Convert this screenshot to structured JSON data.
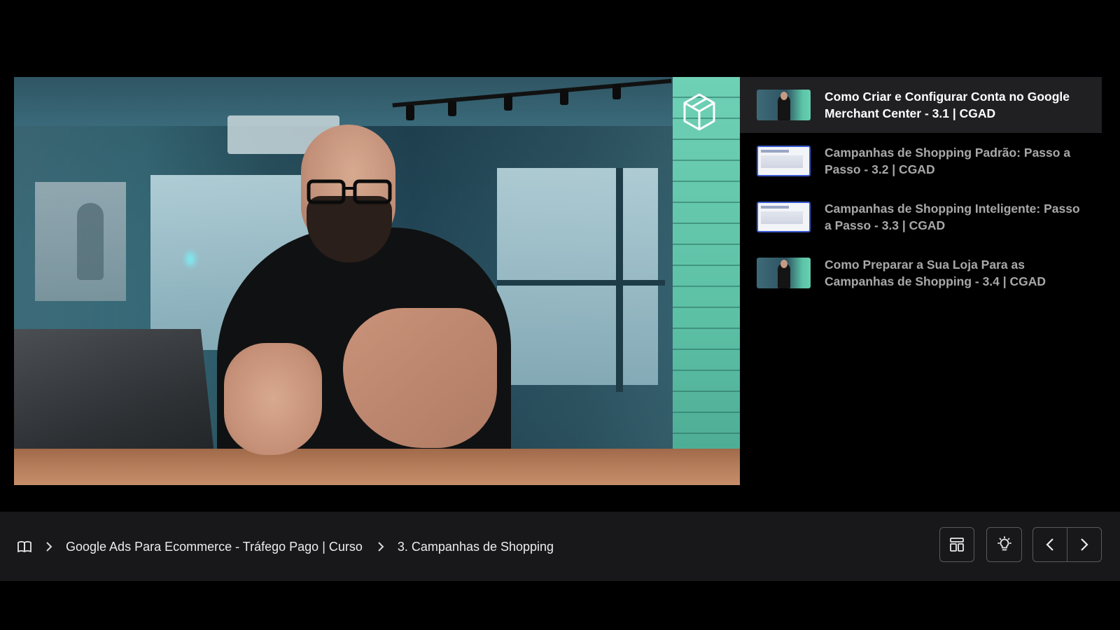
{
  "video": {
    "description_icon": "cube-logo-icon"
  },
  "playlist": {
    "items": [
      {
        "title": "Como Criar e Configurar Conta no Google Merchant Center - 3.1 | CGAD",
        "thumb": "person",
        "active": true
      },
      {
        "title": "Campanhas de Shopping Padrão: Passo a Passo - 3.2 | CGAD",
        "thumb": "screen",
        "active": false
      },
      {
        "title": "Campanhas de Shopping Inteligente: Passo a Passo - 3.3 | CGAD",
        "thumb": "screen",
        "active": false
      },
      {
        "title": "Como Preparar a Sua Loja Para as Campanhas de Shopping - 3.4 | CGAD",
        "thumb": "person",
        "active": false
      }
    ]
  },
  "breadcrumb": {
    "course": "Google Ads Para Ecommerce - Tráfego Pago | Curso",
    "module": "3. Campanhas de Shopping"
  },
  "controls": {
    "layout_icon": "layout-icon",
    "light_icon": "lightbulb-icon",
    "prev_icon": "chevron-left-icon",
    "next_icon": "chevron-right-icon"
  },
  "colors": {
    "background": "#000000",
    "bar": "#18181a",
    "active_item": "#202022",
    "inactive_text": "#a8a8a8"
  }
}
